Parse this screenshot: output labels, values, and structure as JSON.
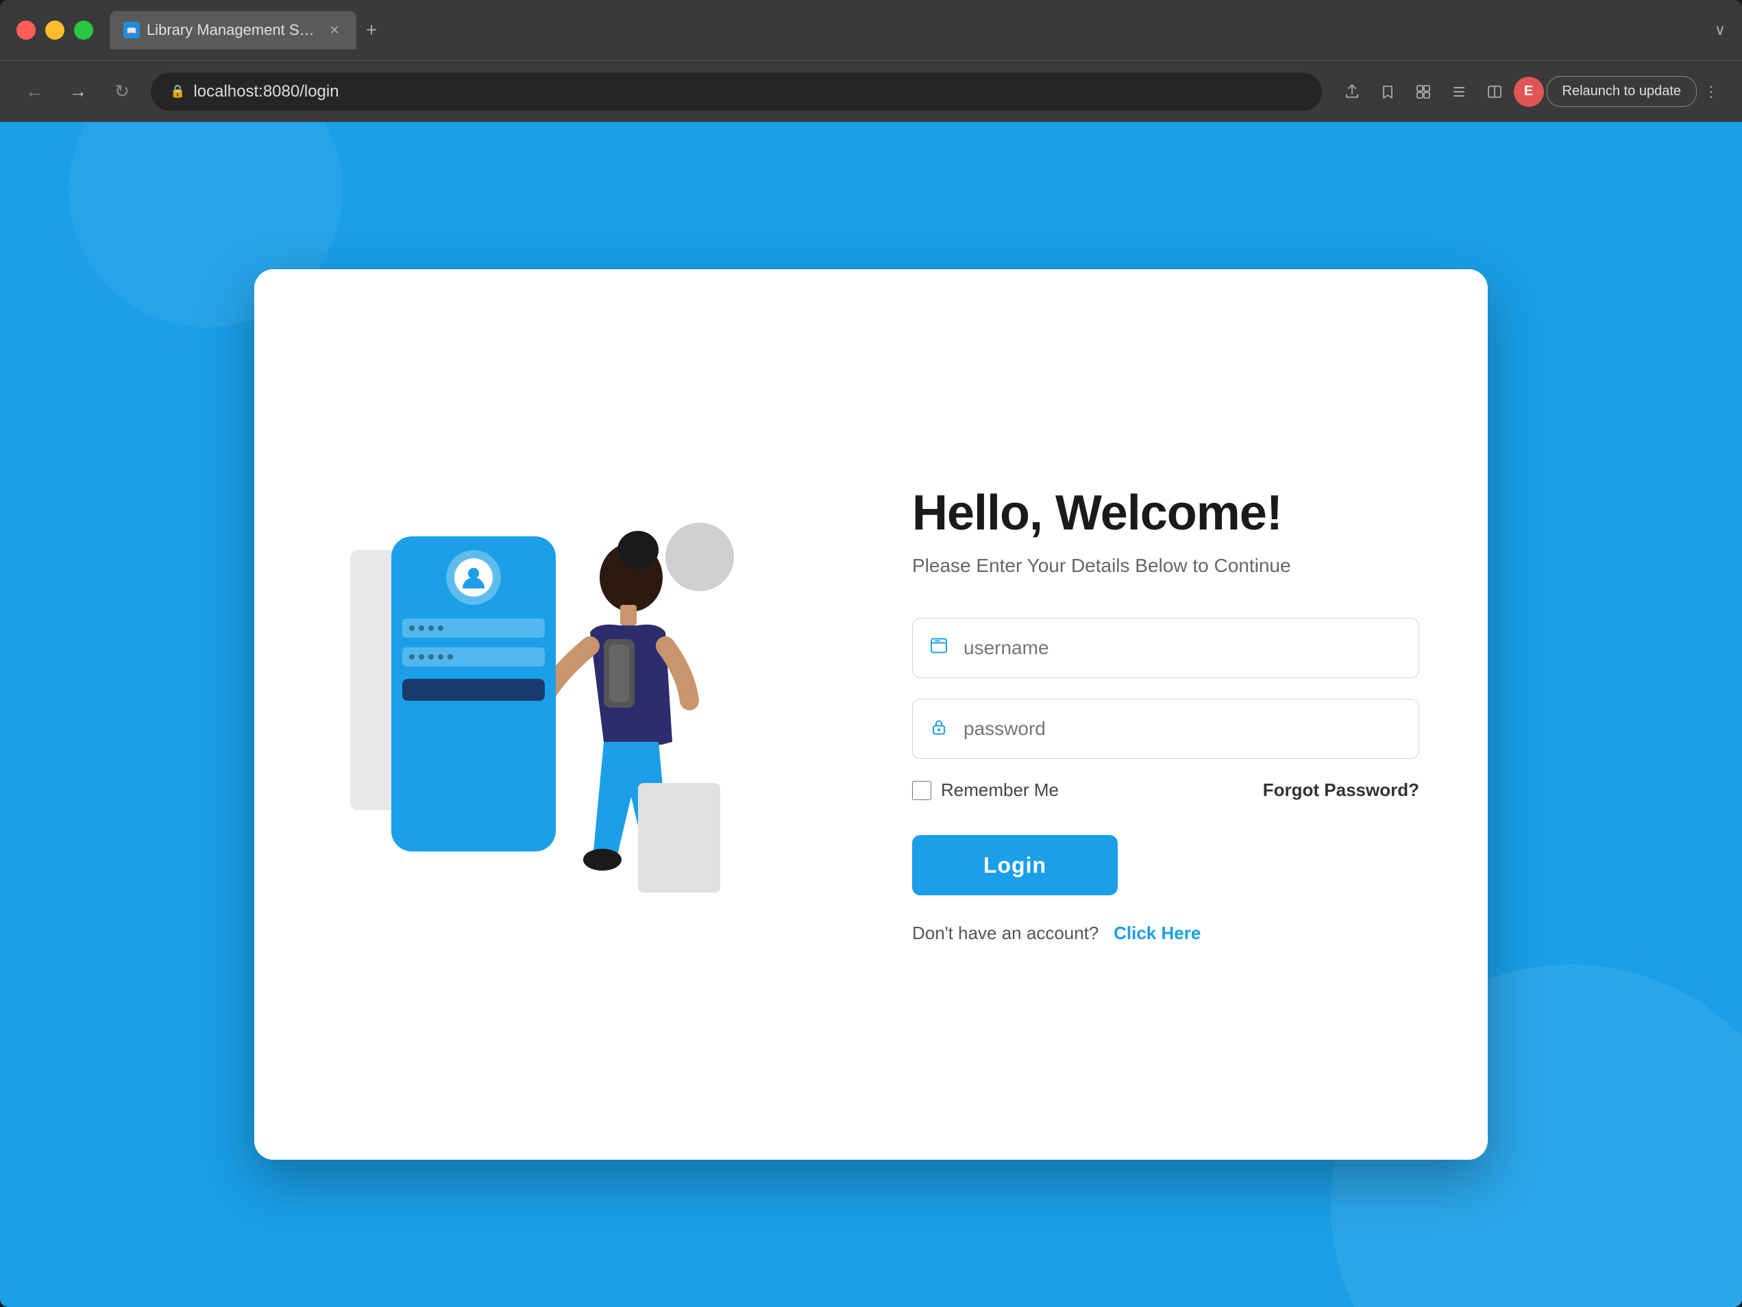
{
  "browser": {
    "tab_title": "Library Management System",
    "tab_favicon_letter": "📚",
    "url": "localhost:8080/login",
    "relaunch_label": "Relaunch to update",
    "profile_letter": "E",
    "new_tab_symbol": "+",
    "dropdown_symbol": "∨"
  },
  "page": {
    "heading": "Hello,  Welcome!",
    "subheading": "Please Enter Your Details Below to Continue",
    "username_placeholder": "username",
    "password_placeholder": "password",
    "remember_me_label": "Remember Me",
    "forgot_password_label": "Forgot Password?",
    "login_button_label": "Login",
    "signup_prompt": "Don't have an account?",
    "signup_link": "Click Here"
  }
}
